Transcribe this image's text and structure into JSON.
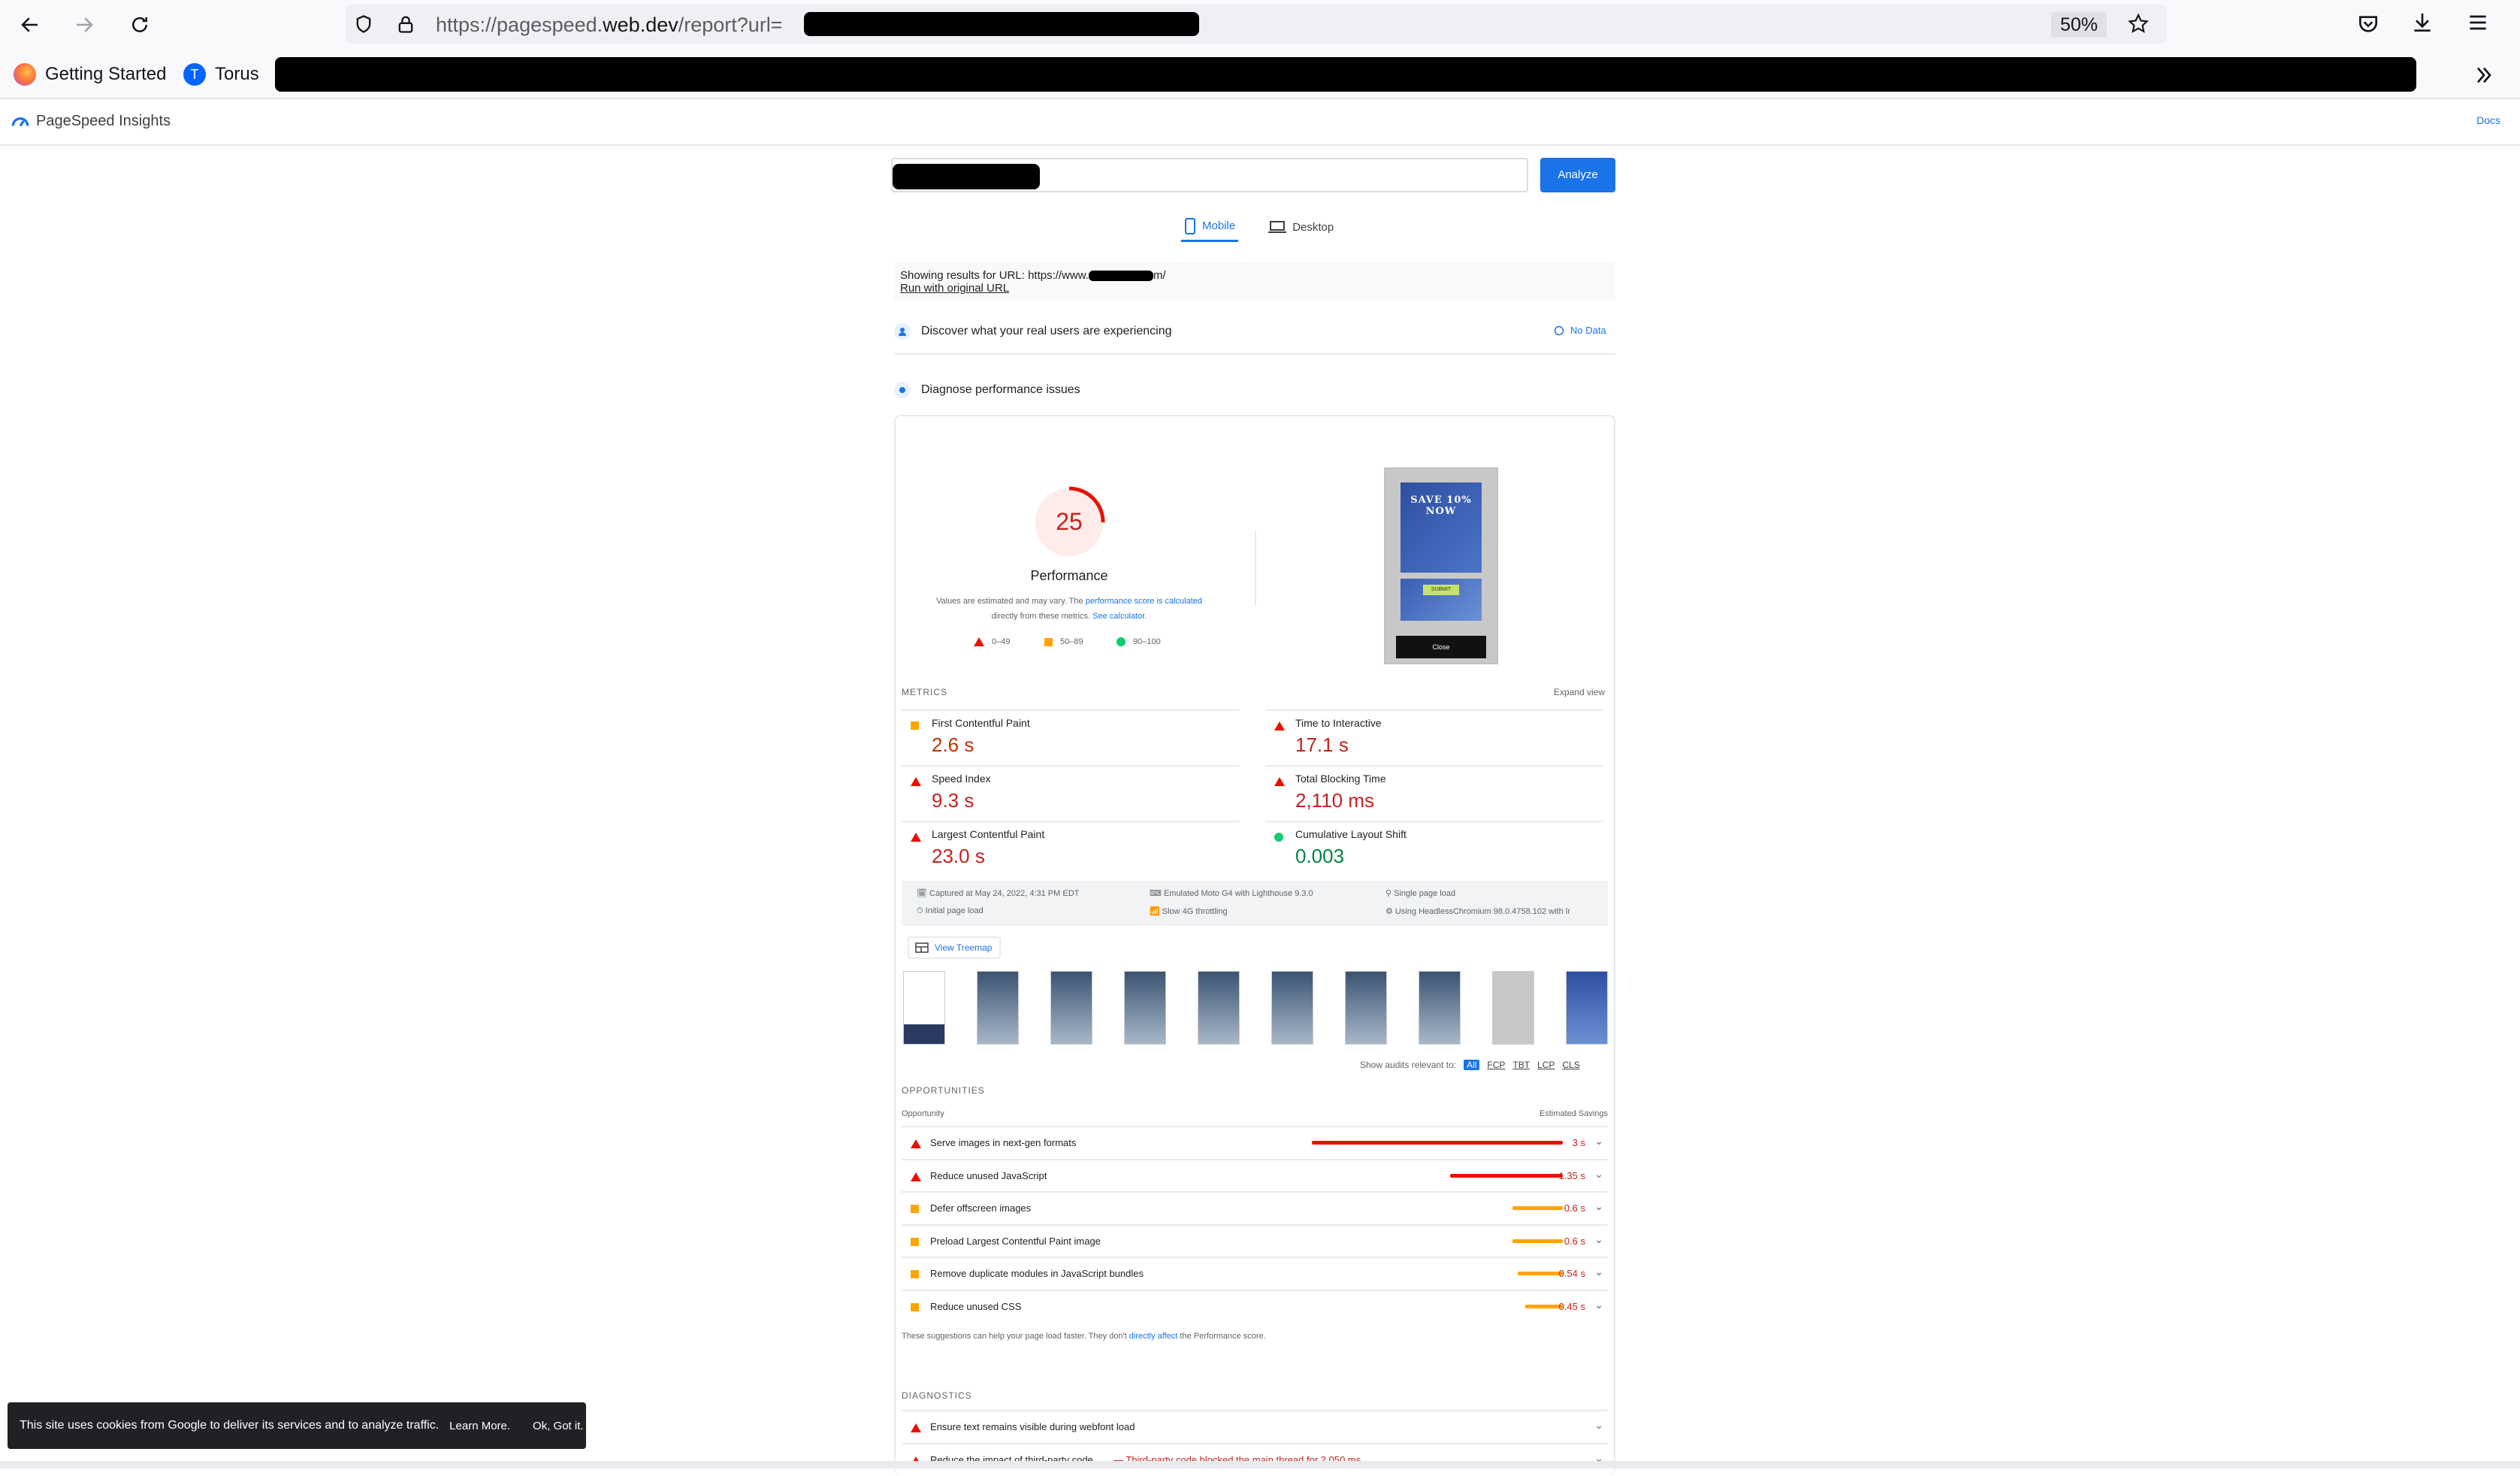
{
  "browser": {
    "url_prefix": "https://pagespeed.",
    "url_domain": "web.dev",
    "url_suffix": "/report?url=",
    "zoom": "50%",
    "bookmarks": [
      "Getting Started",
      "Torus"
    ]
  },
  "psi": {
    "logo_text": "PageSpeed Insights",
    "docs": "Docs",
    "analyze": "Analyze",
    "tabs": [
      "Mobile",
      "Desktop"
    ],
    "showing": "Showing results for URL: https://www.",
    "showing_end": "m/",
    "run_original": "Run with original URL",
    "discover": "Discover what your real users are experiencing",
    "no_data": "No Data",
    "diagnose": "Diagnose performance issues"
  },
  "performance": {
    "score": "25",
    "score_value": 25,
    "label": "Performance",
    "note_a": "Values are estimated and may vary. The ",
    "note_link": "performance score is calculated",
    "note_b": "directly from these metrics. ",
    "note_link2": "See calculator.",
    "legend": [
      "0–49",
      "50–89",
      "90–100"
    ]
  },
  "screenshot": {
    "headline": "SAVE 10% NOW",
    "submit": "SUBMIT",
    "close": "Close"
  },
  "metrics": {
    "heading": "METRICS",
    "expand": "Expand view",
    "items": [
      {
        "name": "First Contentful Paint",
        "value": "2.6 s",
        "status": "average"
      },
      {
        "name": "Time to Interactive",
        "value": "17.1 s",
        "status": "fail"
      },
      {
        "name": "Speed Index",
        "value": "9.3 s",
        "status": "fail"
      },
      {
        "name": "Total Blocking Time",
        "value": "2,110 ms",
        "status": "fail"
      },
      {
        "name": "Largest Contentful Paint",
        "value": "23.0 s",
        "status": "fail"
      },
      {
        "name": "Cumulative Layout Shift",
        "value": "0.003",
        "status": "pass"
      }
    ]
  },
  "runinfo": {
    "captured": "Captured at May 24, 2022, 4:31 PM EDT",
    "emulated": "Emulated Moto G4 with Lighthouse 9.3.0",
    "single": "Single page load",
    "initial": "Initial page load",
    "throttle": "Slow 4G throttling",
    "chromium": "Using HeadlessChromium 98.0.4758.102 with lr"
  },
  "treemap": "View Treemap",
  "relevant": {
    "label": "Show audits relevant to:",
    "chips": [
      "All",
      "FCP",
      "TBT",
      "LCP",
      "CLS"
    ]
  },
  "opportunities": {
    "heading": "OPPORTUNITIES",
    "col_left": "Opportunity",
    "col_right": "Estimated Savings",
    "items": [
      {
        "name": "Serve images in next-gen formats",
        "savings": "3 s",
        "fraction": 1.0,
        "status": "fail"
      },
      {
        "name": "Reduce unused JavaScript",
        "savings": "1.35 s",
        "fraction": 0.45,
        "status": "fail"
      },
      {
        "name": "Defer offscreen images",
        "savings": "0.6 s",
        "fraction": 0.2,
        "status": "average"
      },
      {
        "name": "Preload Largest Contentful Paint image",
        "savings": "0.6 s",
        "fraction": 0.2,
        "status": "average"
      },
      {
        "name": "Remove duplicate modules in JavaScript bundles",
        "savings": "0.54 s",
        "fraction": 0.18,
        "status": "average"
      },
      {
        "name": "Reduce unused CSS",
        "savings": "0.45 s",
        "fraction": 0.15,
        "status": "average"
      }
    ],
    "note_a": "These suggestions can help your page load faster. They don't ",
    "note_link": "directly affect",
    "note_b": " the Performance score."
  },
  "diagnostics": {
    "heading": "DIAGNOSTICS",
    "items": [
      {
        "name": "Ensure text remains visible during webfont load",
        "extra": ""
      },
      {
        "name": "Reduce the impact of third-party code",
        "extra": "— Third-party code blocked the main thread for 2,050 ms"
      }
    ]
  },
  "cookie": {
    "text": "This site uses cookies from Google to deliver its services and to analyze traffic.",
    "learn": "Learn More.",
    "ok": "Ok, Got it."
  },
  "colors": {
    "fail": "#eb0f00",
    "average": "#ffa400",
    "pass": "#0cce6b",
    "accent": "#1a73e8"
  }
}
